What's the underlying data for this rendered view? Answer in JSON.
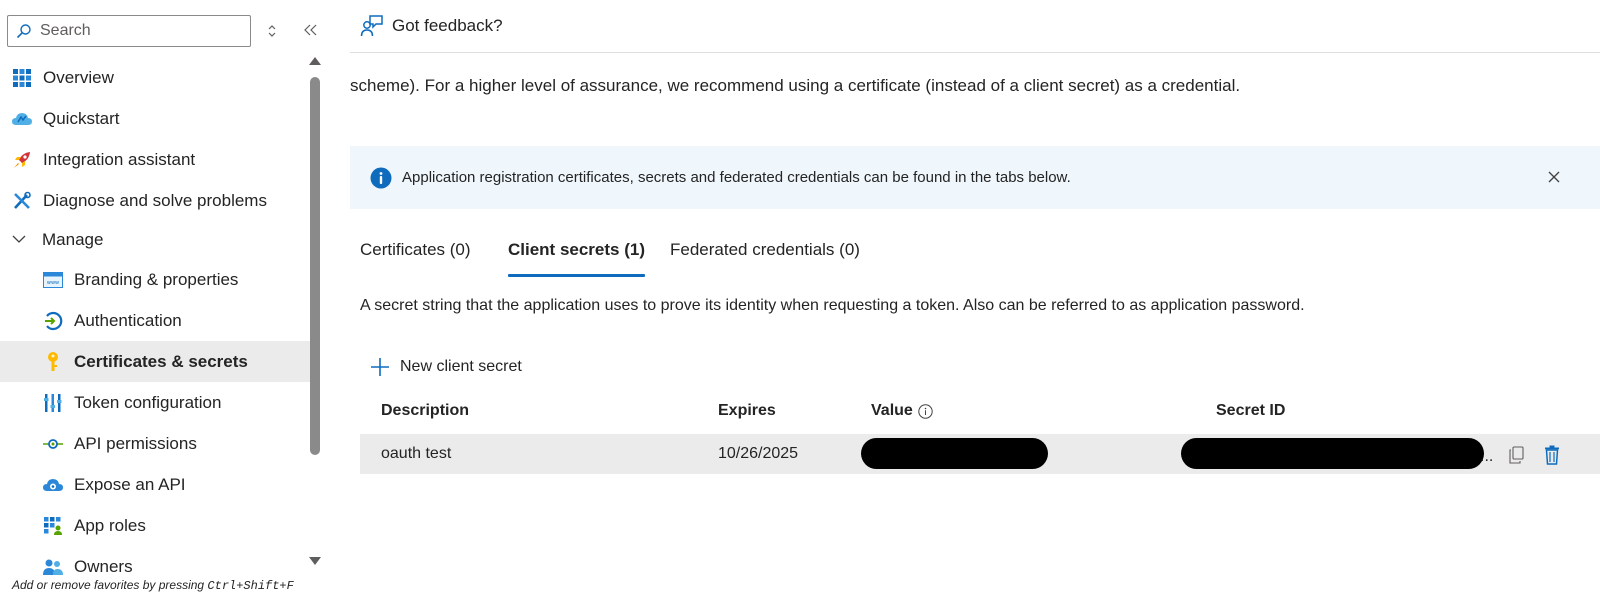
{
  "sidebar": {
    "search": {
      "placeholder": "Search"
    },
    "items": [
      {
        "label": "Overview",
        "icon": "overview-grid-icon"
      },
      {
        "label": "Quickstart",
        "icon": "quickstart-cloud-icon"
      },
      {
        "label": "Integration assistant",
        "icon": "rocket-icon"
      },
      {
        "label": "Diagnose and solve problems",
        "icon": "wrench-icon"
      }
    ],
    "manage_group": {
      "label": "Manage",
      "expanded": true
    },
    "sub_items": [
      {
        "label": "Branding & properties",
        "icon": "branding-icon"
      },
      {
        "label": "Authentication",
        "icon": "authentication-icon"
      },
      {
        "label": "Certificates & secrets",
        "icon": "key-icon",
        "active": true
      },
      {
        "label": "Token configuration",
        "icon": "token-bars-icon"
      },
      {
        "label": "API permissions",
        "icon": "api-permissions-icon"
      },
      {
        "label": "Expose an API",
        "icon": "expose-api-cloud-icon"
      },
      {
        "label": "App roles",
        "icon": "app-roles-icon"
      },
      {
        "label": "Owners",
        "icon": "owners-icon"
      }
    ],
    "fav_hint": {
      "prefix": "Add or remove favorites by pressing ",
      "shortcut": "Ctrl+Shift+F"
    }
  },
  "cmdbar": {
    "feedback_label": "Got feedback?"
  },
  "main": {
    "intro": "scheme). For a higher level of assurance, we recommend using a certificate (instead of a client secret) as a credential.",
    "infobar": {
      "text": "Application registration certificates, secrets and federated credentials can be found in the tabs below."
    },
    "tabs": [
      {
        "label": "Certificates (0)"
      },
      {
        "label": "Client secrets (1)",
        "active": true
      },
      {
        "label": "Federated credentials (0)"
      }
    ],
    "description": "A secret string that the application uses to prove its identity when requesting a token. Also can be referred to as application password.",
    "new_secret_label": "New client secret",
    "table": {
      "columns": [
        "Description",
        "Expires",
        "Value",
        "Secret ID"
      ],
      "rows": [
        {
          "description": "oauth test",
          "expires": "10/26/2025",
          "value": "",
          "secret_id": "",
          "truncation": "..."
        }
      ]
    }
  },
  "colors": {
    "accent": "#0f6cbd",
    "info_bg": "#eff6fc",
    "active_bg": "#ebebeb"
  }
}
